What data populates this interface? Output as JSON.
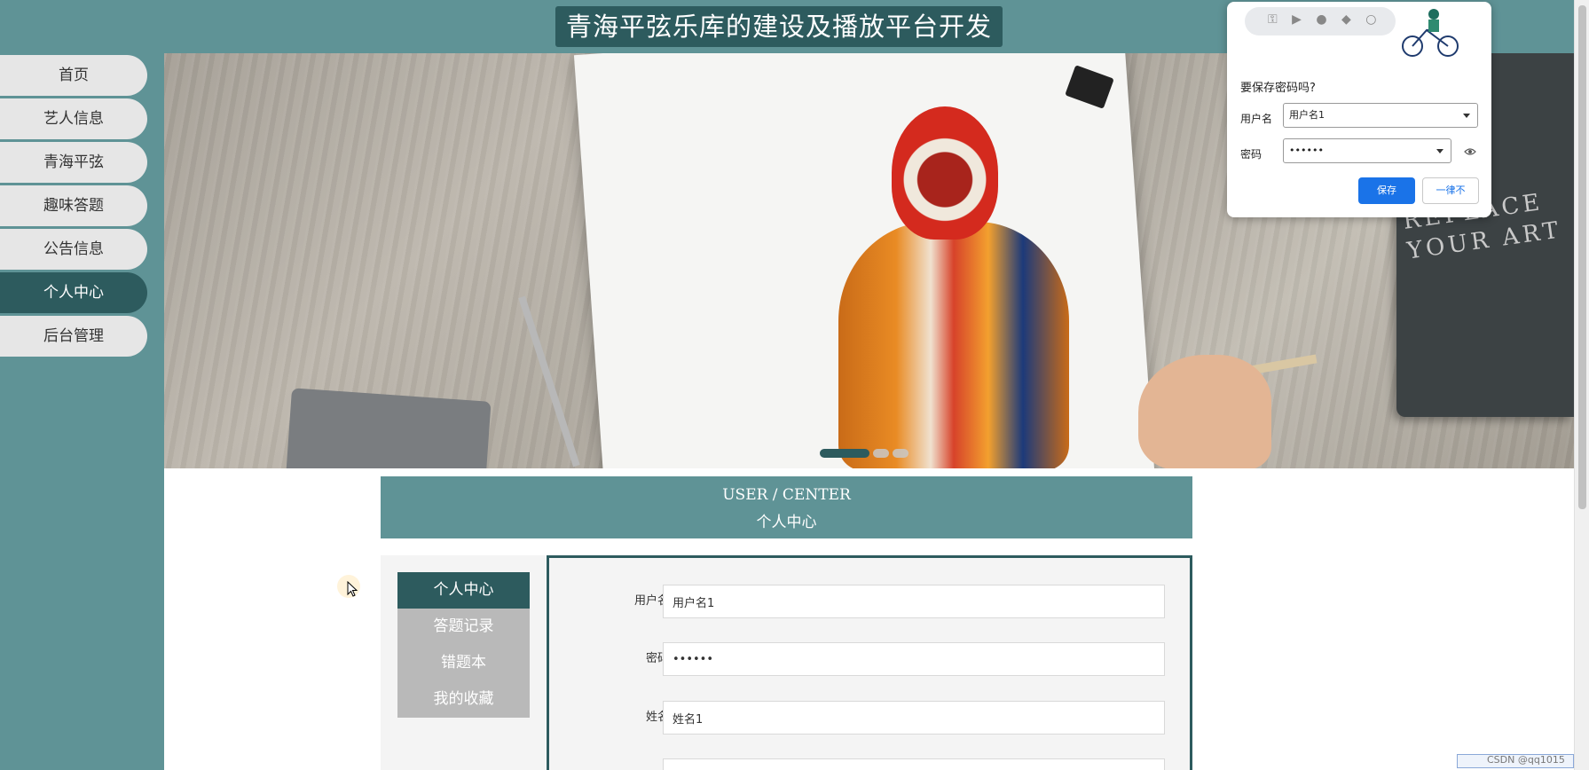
{
  "header": {
    "title": "青海平弦乐库的建设及播放平台开发"
  },
  "sidebar": {
    "items": [
      {
        "label": "首页"
      },
      {
        "label": "艺人信息"
      },
      {
        "label": "青海平弦"
      },
      {
        "label": "趣味答题"
      },
      {
        "label": "公告信息"
      },
      {
        "label": "个人中心"
      },
      {
        "label": "后台管理"
      }
    ],
    "active_index": 5
  },
  "banner": {
    "book_text": "REPLACE YOUR ART",
    "carousel": {
      "slides": 3,
      "active": 1
    }
  },
  "center": {
    "title_en": "USER / CENTER",
    "title_cn": "个人中心"
  },
  "side_menu": {
    "items": [
      {
        "label": "个人中心"
      },
      {
        "label": "答题记录"
      },
      {
        "label": "错题本"
      },
      {
        "label": "我的收藏"
      }
    ],
    "active_index": 0
  },
  "form": {
    "fields": [
      {
        "label": "用户名",
        "value": "用户名1"
      },
      {
        "label": "密码",
        "value": "••••••"
      },
      {
        "label": "姓名",
        "value": "姓名1"
      }
    ]
  },
  "password_popup": {
    "title": "要保存密码吗?",
    "username_label": "用户名",
    "username_value": "用户名1",
    "password_label": "密码",
    "password_value": "••••••",
    "save_label": "保存",
    "never_label": "一律不"
  },
  "watermark": {
    "text": "CSDN @qq1015"
  },
  "colors": {
    "primary": "#5f9396",
    "dark": "#2d5b5e",
    "chrome_blue": "#1a73e8"
  }
}
